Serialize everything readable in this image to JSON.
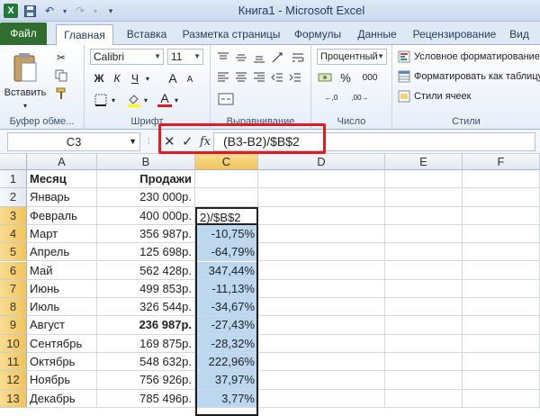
{
  "titlebar": {
    "title": "Книга1  -  Microsoft Excel",
    "app_logo": "X"
  },
  "tabs": [
    "Файл",
    "Главная",
    "Вставка",
    "Разметка страницы",
    "Формулы",
    "Данные",
    "Рецензирование",
    "Вид"
  ],
  "ribbon": {
    "clipboard": {
      "paste_label": "Вставить",
      "group_label": "Буфер обме..."
    },
    "font": {
      "font_name": "Calibri",
      "font_size": "11",
      "group_label": "Шрифт",
      "bold": "Ж",
      "italic": "К",
      "underline": "Ч",
      "grow": "A",
      "shrink": "A",
      "font_color": "A"
    },
    "alignment": {
      "group_label": "Выравнивание"
    },
    "number": {
      "format": "Процентный",
      "group_label": "Число"
    },
    "styles": {
      "conditional": "Условное форматирование",
      "as_table": "Форматировать как таблицу",
      "cell_styles": "Стили ячеек",
      "group_label": "Стили"
    }
  },
  "formula_bar": {
    "name_box": "C3",
    "fx": "fx",
    "formula": "(B3-B2)/$B$2"
  },
  "columns": [
    "A",
    "B",
    "C",
    "D",
    "E",
    "F"
  ],
  "rows": [
    {
      "n": "1",
      "a": "Месяц",
      "b": "Продажи",
      "c": "",
      "bold": true
    },
    {
      "n": "2",
      "a": "Январь",
      "b": "230 000р.",
      "c": ""
    },
    {
      "n": "3",
      "a": "Февраль",
      "b": "400 000р.",
      "c": "2)/$B$2"
    },
    {
      "n": "4",
      "a": "Март",
      "b": "356 987р.",
      "c": "-10,75%"
    },
    {
      "n": "5",
      "a": "Апрель",
      "b": "125 698р.",
      "c": "-64,79%"
    },
    {
      "n": "6",
      "a": "Май",
      "b": "562 428р.",
      "c": "347,44%"
    },
    {
      "n": "7",
      "a": "Июнь",
      "b": "499 853р.",
      "c": "-11,13%"
    },
    {
      "n": "8",
      "a": "Июль",
      "b": "326 544р.",
      "c": "-34,67%"
    },
    {
      "n": "9",
      "a": "Август",
      "b": "236 987р.",
      "c": "-27,43%",
      "bold_b": true
    },
    {
      "n": "10",
      "a": "Сентябрь",
      "b": "169 875р.",
      "c": "-28,32%"
    },
    {
      "n": "11",
      "a": "Октябрь",
      "b": "548 632р.",
      "c": "222,96%"
    },
    {
      "n": "12",
      "a": "Ноябрь",
      "b": "756 926р.",
      "c": "37,97%"
    },
    {
      "n": "13",
      "a": "Декабрь",
      "b": "785 496р.",
      "c": "3,77%"
    }
  ]
}
